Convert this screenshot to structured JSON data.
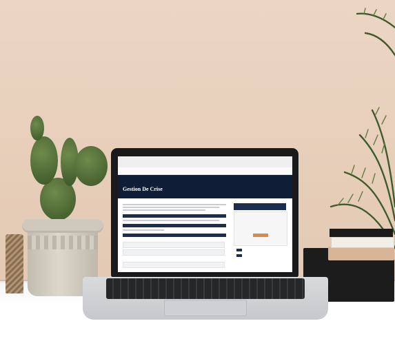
{
  "screen": {
    "hero_title": "Gestion De Crise"
  },
  "colors": {
    "wall": "#e6cdb8",
    "desk": "#ffffff",
    "hero_bg": "#0f1d36",
    "accent_button": "#d98a4b",
    "cactus": "#4f6a35"
  }
}
